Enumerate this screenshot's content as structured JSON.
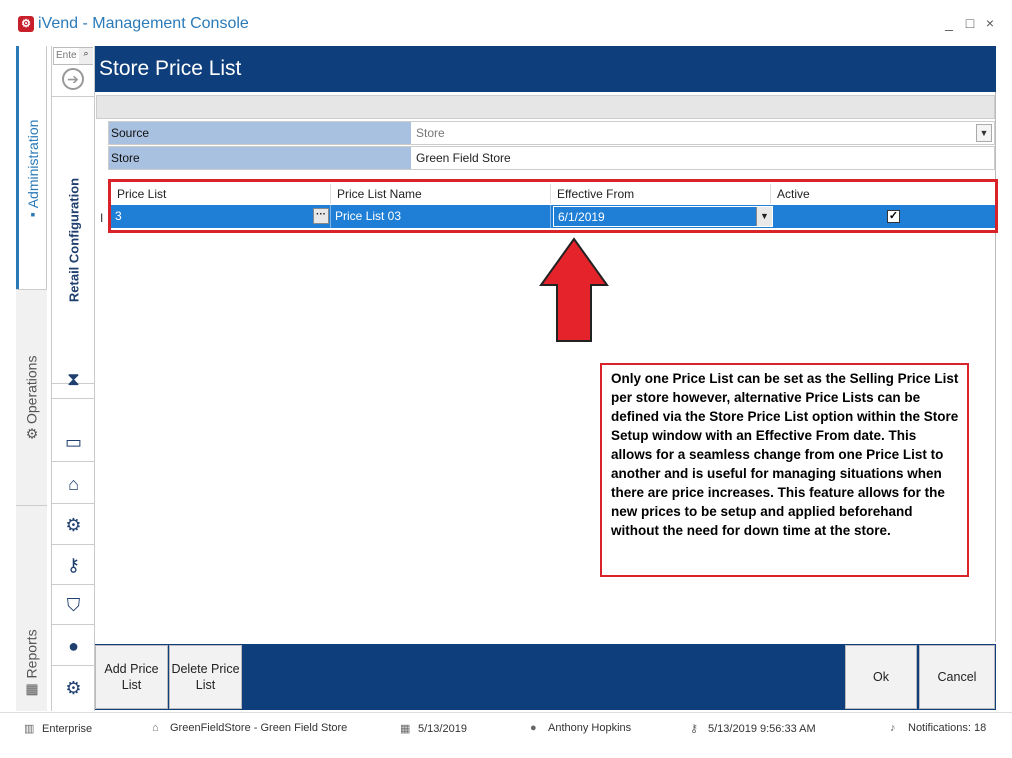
{
  "window": {
    "logo": "⚙",
    "title": "iVend - Management Console",
    "controls": [
      "_",
      "□",
      "×"
    ]
  },
  "outer_nav": {
    "administration": "Administration",
    "operations": "Operations",
    "reports": "Reports"
  },
  "inner_nav": {
    "search_placeholder": "Ente",
    "retail_configuration": "Retail Configuration",
    "icons": [
      "hourglass-icon",
      "terminal-icon",
      "bank-icon",
      "gears-icon",
      "key-search-icon",
      "shield-icon",
      "user-icon",
      "settings-gear-icon"
    ]
  },
  "page": {
    "title": "Store Price List"
  },
  "form": {
    "source_label": "Source",
    "source_value": "Store",
    "store_label": "Store",
    "store_value": "Green Field Store"
  },
  "grid": {
    "columns": [
      "Price List",
      "Price List Name",
      "Effective From",
      "Active"
    ],
    "rows": [
      {
        "price_list": "3",
        "price_list_name": "Price List 03",
        "effective_from": "6/1/2019",
        "active": true
      }
    ]
  },
  "note": "Only one Price List can be set as the Selling Price List per store however, alternative Price Lists can be defined via the Store Price List option within the Store Setup window with an Effective From date. This allows for a seamless change from one Price List to another and is useful for managing situations when there are price increases. This feature allows for the new prices to be setup and applied beforehand without the need for down time at the store.",
  "actions": {
    "add_price_list": "Add Price List",
    "delete_price_list": "Delete Price List",
    "ok": "Ok",
    "cancel": "Cancel"
  },
  "status_bar": {
    "enterprise": "Enterprise",
    "store": "GreenFieldStore - Green Field Store",
    "date": "5/13/2019",
    "user": "Anthony Hopkins",
    "login_time": "5/13/2019 9:56:33 AM",
    "notifications": "Notifications: 18"
  },
  "colors": {
    "header_blue": "#0e3f7c",
    "accent_blue": "#2a7ab8",
    "selection_blue": "#1f7ed6",
    "annotation_red": "#d9232a",
    "label_blue": "#a9c1e0"
  }
}
